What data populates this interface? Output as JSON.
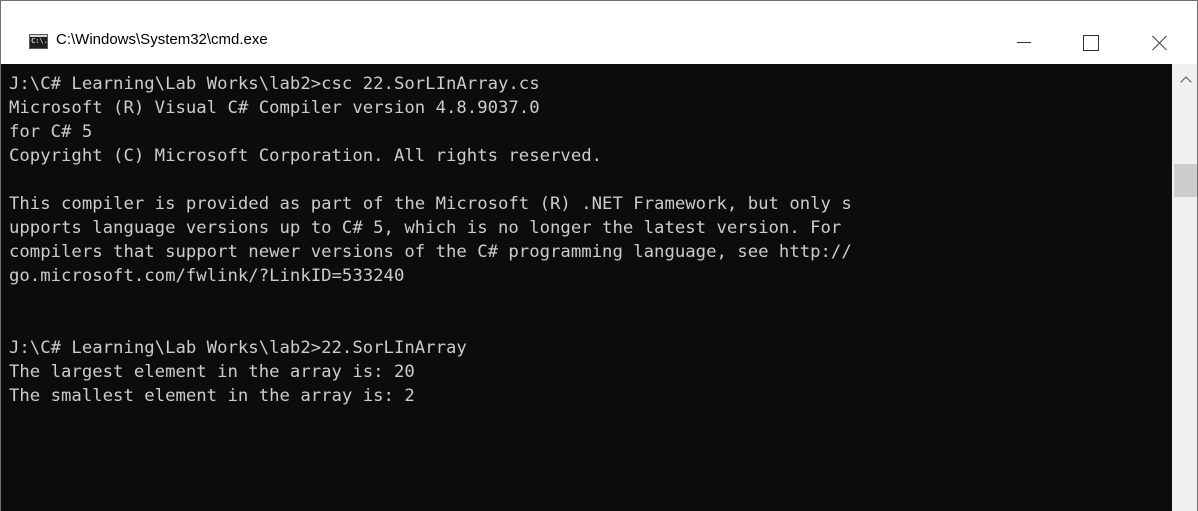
{
  "window": {
    "title": "C:\\Windows\\System32\\cmd.exe",
    "icon": "cmd-icon",
    "icon_text": "C:\\."
  },
  "controls": {
    "minimize_icon": "minimize-icon",
    "maximize_icon": "maximize-icon",
    "close_icon": "close-icon"
  },
  "console": {
    "lines": [
      "J:\\C# Learning\\Lab Works\\lab2>csc 22.SorLInArray.cs",
      "Microsoft (R) Visual C# Compiler version 4.8.9037.0",
      "for C# 5",
      "Copyright (C) Microsoft Corporation. All rights reserved.",
      "",
      "This compiler is provided as part of the Microsoft (R) .NET Framework, but only s",
      "upports language versions up to C# 5, which is no longer the latest version. For",
      "compilers that support newer versions of the C# programming language, see http://",
      "go.microsoft.com/fwlink/?LinkID=533240",
      "",
      "",
      "J:\\C# Learning\\Lab Works\\lab2>22.SorLInArray",
      "The largest element in the array is: 20",
      "The smallest element in the array is: 2"
    ]
  },
  "colors": {
    "console_bg": "#0c0c0c",
    "console_text": "#cccccc",
    "titlebar_bg": "#ffffff"
  }
}
